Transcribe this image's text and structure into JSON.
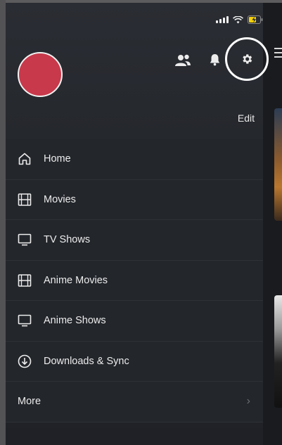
{
  "header": {
    "edit_label": "Edit"
  },
  "menu": {
    "items": [
      {
        "label": "Home",
        "icon": "home-icon"
      },
      {
        "label": "Movies",
        "icon": "film-icon"
      },
      {
        "label": "TV Shows",
        "icon": "tv-icon"
      },
      {
        "label": "Anime Movies",
        "icon": "film-icon"
      },
      {
        "label": "Anime Shows",
        "icon": "tv-icon"
      },
      {
        "label": "Downloads & Sync",
        "icon": "download-icon"
      }
    ],
    "more_label": "More"
  },
  "colors": {
    "avatar": "#c8394b",
    "drawer_bg": "#25282d",
    "battery_accent": "#f5d10a"
  }
}
